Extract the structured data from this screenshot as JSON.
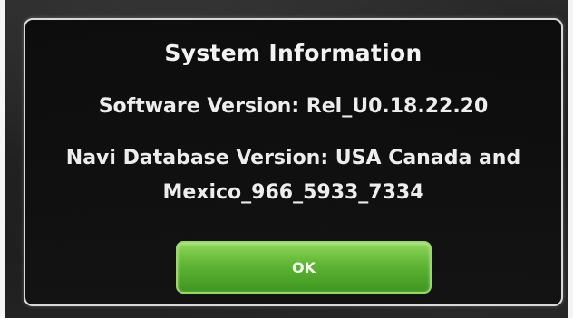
{
  "dialog": {
    "title": "System Information",
    "software_version": "Software Version: Rel_U0.18.22.20",
    "navi_database_line1": "Navi Database Version: USA Canada and",
    "navi_database_line2": "Mexico_966_5933_7334",
    "ok_label": "OK"
  },
  "colors": {
    "button_green": "#5fb534",
    "text": "#ededed",
    "background": "#1a1a1a"
  }
}
